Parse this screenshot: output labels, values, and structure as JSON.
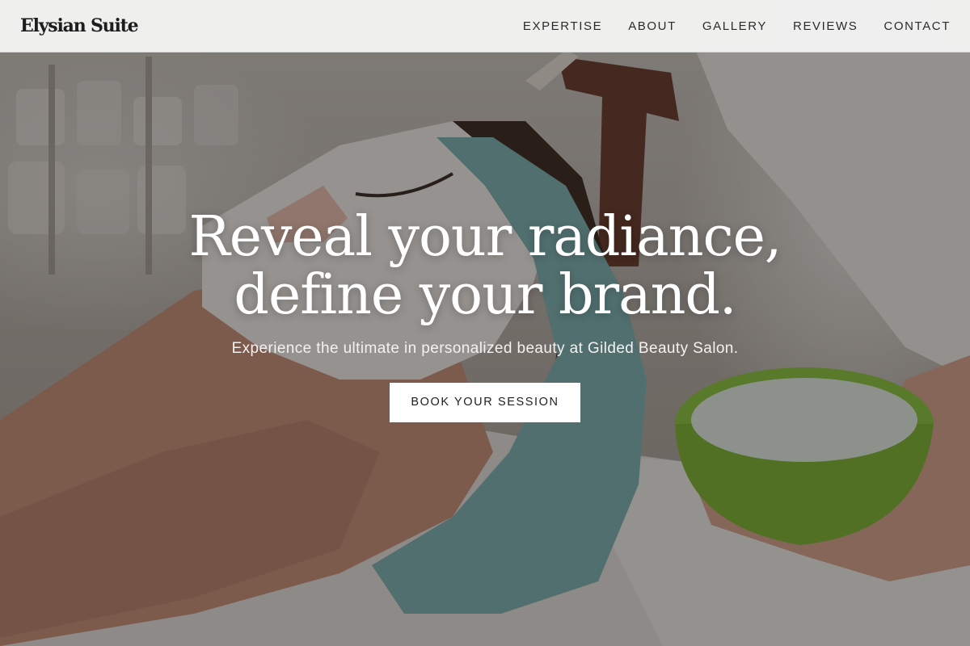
{
  "brand": {
    "name": "Elysian Suite"
  },
  "nav": {
    "items": [
      {
        "label": "EXPERTISE"
      },
      {
        "label": "ABOUT"
      },
      {
        "label": "GALLERY"
      },
      {
        "label": "REVIEWS"
      },
      {
        "label": "CONTACT"
      }
    ]
  },
  "hero": {
    "headline_line1": "Reveal your radiance,",
    "headline_line2": "define your brand.",
    "subheadline": "Experience the ultimate in personalized beauty at Gilded Beauty Salon.",
    "cta_label": "BOOK YOUR SESSION",
    "image_description_icon": "facial-treatment-photo"
  },
  "colors": {
    "navbar_bg": "#f8f8f8",
    "text_dark": "#1d1d1d",
    "hero_text": "#ffffff",
    "cta_bg": "#ffffff",
    "headband": "#7fb3b5",
    "bowl": "#8cc63f"
  }
}
